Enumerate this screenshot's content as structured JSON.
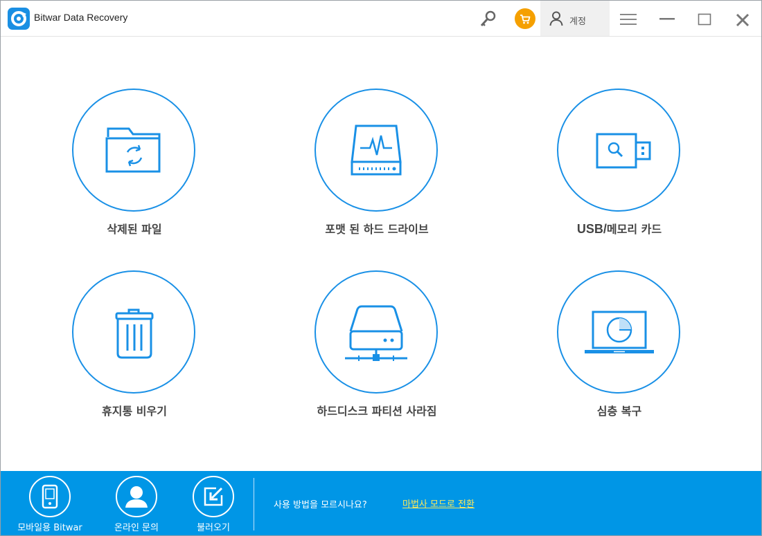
{
  "window": {
    "title": "Bitwar Data Recovery",
    "account_label": "계정"
  },
  "icons": {
    "logo": "bitwar-logo",
    "key": "key-icon",
    "cart": "cart-icon",
    "user": "user-icon",
    "menu": "hamburger-menu-icon",
    "minimize": "minimize-icon",
    "maximize": "maximize-icon",
    "close": "close-icon"
  },
  "colors": {
    "accent": "#1990e6",
    "bottom_bar": "#0096e6",
    "cart_badge": "#f5a000",
    "link": "#ffe95a"
  },
  "modes": [
    {
      "label": "삭제된 파일",
      "icon": "deleted-folder-icon"
    },
    {
      "label": "포맷 된 하드 드라이브",
      "icon": "formatted-drive-icon"
    },
    {
      "label_en": "USB/",
      "label_ko": "메모리 카드",
      "icon": "usb-memory-card-icon"
    },
    {
      "label": "휴지통 비우기",
      "icon": "recycle-bin-icon"
    },
    {
      "label": "하드디스크 파티션 사라짐",
      "icon": "lost-partition-icon"
    },
    {
      "label": "심층 복구",
      "icon": "deep-scan-laptop-icon"
    }
  ],
  "footer": {
    "mobile_label": "모바일용 Bitwar",
    "support_label": "온라인 문의",
    "import_label": "불러오기",
    "help_text": "사용 방법을 모르시나요?",
    "wizard_link": "마법사 모드로 전환"
  }
}
